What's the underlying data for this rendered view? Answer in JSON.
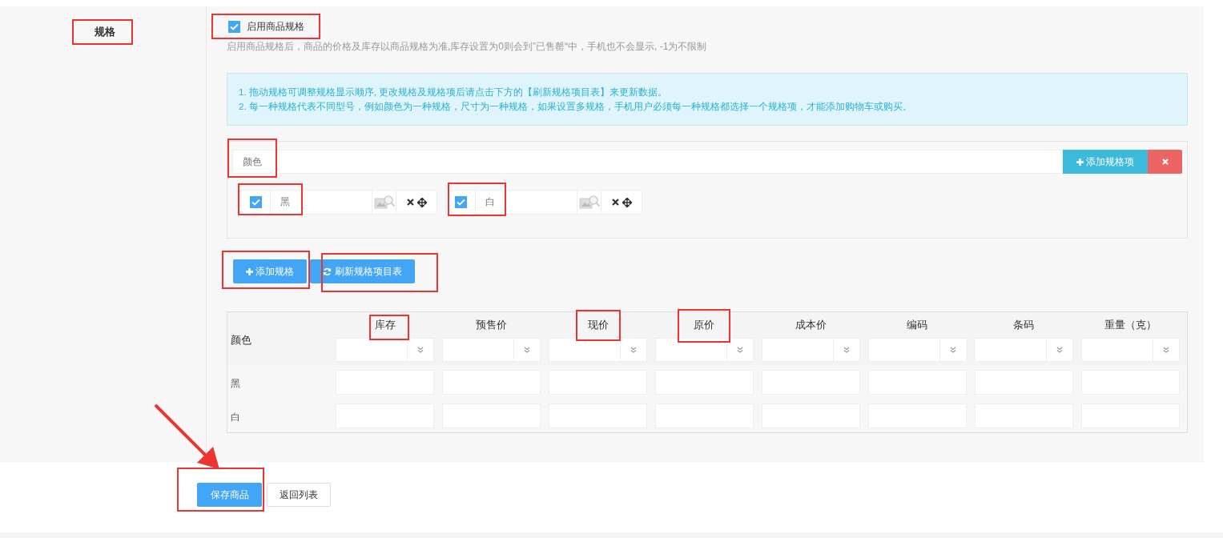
{
  "field_label": "规格",
  "enable_spec": {
    "label": "启用商品规格",
    "checked": true
  },
  "help_text": "启用商品规格后，商品的价格及库存以商品规格为准,库存设置为0则会到”已售罄“中，手机也不会显示, -1为不限制",
  "notice": [
    "1. 拖动规格可调整规格显示顺序, 更改规格及规格项后请点击下方的【刷新规格项目表】来更新数据。",
    "2. 每一种规格代表不同型号，例如颜色为一种规格，尺寸为一种规格，如果设置多规格，手机用户必须每一种规格都选择一个规格项，才能添加购物车或购买。"
  ],
  "spec_groups": [
    {
      "name": "颜色",
      "add_item_button": "添加规格项",
      "items": [
        {
          "value": "黑",
          "checked": true
        },
        {
          "value": "白",
          "checked": true
        }
      ]
    }
  ],
  "spec_buttons": [
    {
      "kind": "add",
      "label": "添加规格"
    },
    {
      "kind": "refresh",
      "label": "刷新规格项目表"
    }
  ],
  "sku_table": {
    "columns": [
      "颜色",
      "库存",
      "预售价",
      "现价",
      "原价",
      "成本价",
      "编码",
      "条码",
      "重量（克）"
    ],
    "rows": [
      "黑",
      "白"
    ]
  },
  "footer_buttons": [
    {
      "kind": "primary",
      "label": "保存商品"
    },
    {
      "kind": "default",
      "label": "返回列表"
    }
  ]
}
